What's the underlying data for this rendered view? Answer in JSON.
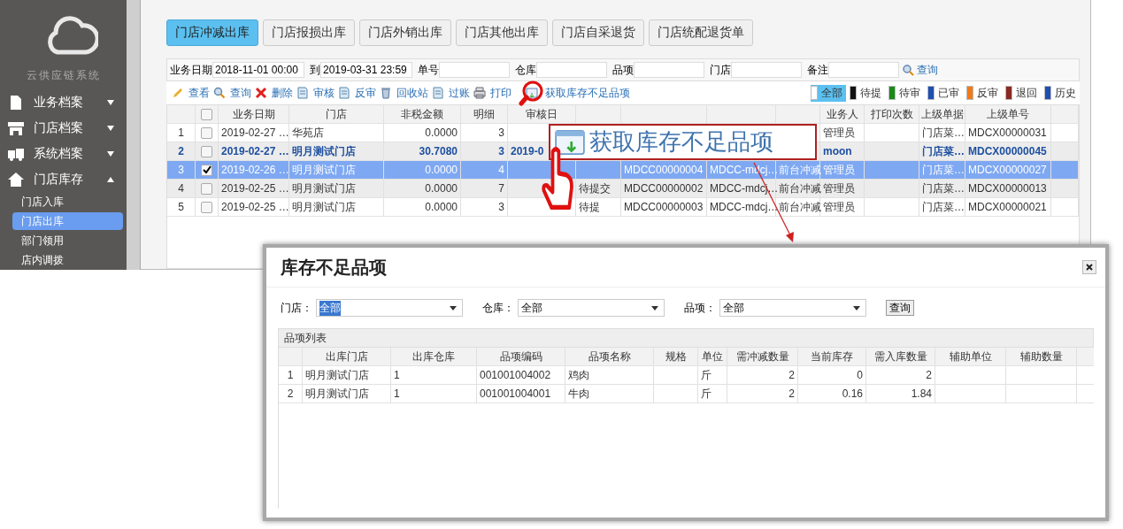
{
  "sidebar": {
    "logo_text": "云供应链系统",
    "menu": [
      {
        "label": "业务档案",
        "expanded": false
      },
      {
        "label": "门店档案",
        "expanded": false
      },
      {
        "label": "系统档案",
        "expanded": false
      },
      {
        "label": "门店库存",
        "expanded": true,
        "children": [
          {
            "label": "门店入库",
            "selected": false
          },
          {
            "label": "门店出库",
            "selected": true
          },
          {
            "label": "部门领用",
            "selected": false
          },
          {
            "label": "店内调拨",
            "selected": false
          }
        ]
      }
    ]
  },
  "tabs": [
    {
      "label": "门店冲减出库",
      "selected": true
    },
    {
      "label": "门店报损出库",
      "selected": false
    },
    {
      "label": "门店外销出库",
      "selected": false
    },
    {
      "label": "门店其他出库",
      "selected": false
    },
    {
      "label": "门店自采退货",
      "selected": false
    },
    {
      "label": "门店统配退货单",
      "selected": false
    }
  ],
  "filters": {
    "date_label": "业务日期",
    "date_from": "2018-11-01 00:00",
    "to_label": "到",
    "date_to": "2019-03-31 23:59",
    "fields": [
      {
        "label": "单号"
      },
      {
        "label": "仓库"
      },
      {
        "label": "品项"
      },
      {
        "label": "门店"
      },
      {
        "label": "备注"
      }
    ],
    "search_button": "查询"
  },
  "toolbar": [
    {
      "label": "查看"
    },
    {
      "label": "查询"
    },
    {
      "label": "删除"
    },
    {
      "label": "审核"
    },
    {
      "label": "反审"
    },
    {
      "label": "回收站"
    },
    {
      "label": "过账"
    },
    {
      "label": "打印"
    },
    {
      "label": "获取库存不足品项"
    }
  ],
  "status_filters": [
    {
      "label": "全部",
      "color": "#ffffff",
      "selected": true
    },
    {
      "label": "待提",
      "color": "#111111",
      "selected": false
    },
    {
      "label": "待审",
      "color": "#1a8a1a",
      "selected": false
    },
    {
      "label": "已审",
      "color": "#1f4fb0",
      "selected": false
    },
    {
      "label": "反审",
      "color": "#f07a1a",
      "selected": false
    },
    {
      "label": "退回",
      "color": "#8a2a22",
      "selected": false
    },
    {
      "label": "历史",
      "color": "#1f4fb0",
      "selected": false
    }
  ],
  "table": {
    "header_checked": false,
    "columns": [
      {
        "label": "业务日期"
      },
      {
        "label": "门店"
      },
      {
        "label": "非税金额"
      },
      {
        "label": "明细"
      },
      {
        "label": "审核日"
      },
      {},
      {},
      {},
      {},
      {
        "label": "业务人"
      },
      {
        "label": "打印次数"
      },
      {
        "label": "上级单据"
      },
      {
        "label": "上级单号"
      },
      {}
    ],
    "rows": [
      {
        "number": "1",
        "checked": false,
        "selected": false,
        "emphasis": false,
        "cells": [
          "2019-02-27 …",
          "华苑店",
          "0.0000",
          "3",
          null,
          null,
          null,
          null,
          null,
          "管理员",
          null,
          "门店菜…",
          "MDCX00000031",
          null
        ]
      },
      {
        "number": "2",
        "checked": false,
        "selected": false,
        "emphasis": true,
        "cells": [
          "2019-02-27 …",
          "明月测试门店",
          "30.7080",
          "3",
          "2019-0",
          null,
          null,
          null,
          null,
          "moon",
          null,
          "门店菜…",
          "MDCX00000045",
          null
        ]
      },
      {
        "number": "3",
        "checked": true,
        "selected": true,
        "emphasis": false,
        "cells": [
          "2019-02-26 …",
          "明月测试门店",
          "0.0000",
          "4",
          null,
          null,
          "MDCC00000004",
          "MDCC-mdcj…",
          "前台冲减",
          "管理员",
          null,
          "门店菜…",
          "MDCX00000027",
          null
        ]
      },
      {
        "number": "4",
        "checked": false,
        "selected": false,
        "emphasis": false,
        "cells": [
          "2019-02-25 …",
          "明月测试门店",
          "0.0000",
          "7",
          null,
          "待提交",
          "MDCC00000002",
          "MDCC-mdcj…",
          "前台冲减",
          "管理员",
          null,
          "门店菜…",
          "MDCX00000013",
          null
        ]
      },
      {
        "number": "5",
        "checked": false,
        "selected": false,
        "emphasis": false,
        "cells": [
          "2019-02-25 …",
          "明月测试门店",
          "0.0000",
          "3",
          null,
          "待提",
          "MDCC00000003",
          "MDCC-mdcj…",
          "前台冲减",
          "管理员",
          null,
          "门店菜…",
          "MDCX00000021",
          null
        ]
      }
    ]
  },
  "callout": {
    "text": "获取库存不足品项"
  },
  "dialog": {
    "title": "库存不足品项",
    "filters": [
      {
        "label": "门店：",
        "value": "全部",
        "highlighted": true
      },
      {
        "label": "仓库：",
        "value": "全部",
        "highlighted": false
      },
      {
        "label": "品项：",
        "value": "全部",
        "highlighted": false
      }
    ],
    "search_button": "查询",
    "section_title": "品项列表",
    "columns": [
      "出库门店",
      "出库仓库",
      "品项编码",
      "品项名称",
      "规格",
      "单位",
      "需冲减数量",
      "当前库存",
      "需入库数量",
      "辅助单位",
      "辅助数量"
    ],
    "rows": [
      {
        "number": "1",
        "cells": [
          "明月测试门店",
          "1",
          "001001004002",
          "鸡肉",
          null,
          "斤",
          "2",
          "0",
          "2",
          null,
          null
        ]
      },
      {
        "number": "2",
        "cells": [
          "明月测试门店",
          "1",
          "001001004001",
          "牛肉",
          null,
          "斤",
          "2",
          "0.16",
          "1.84",
          null,
          null
        ]
      }
    ]
  }
}
